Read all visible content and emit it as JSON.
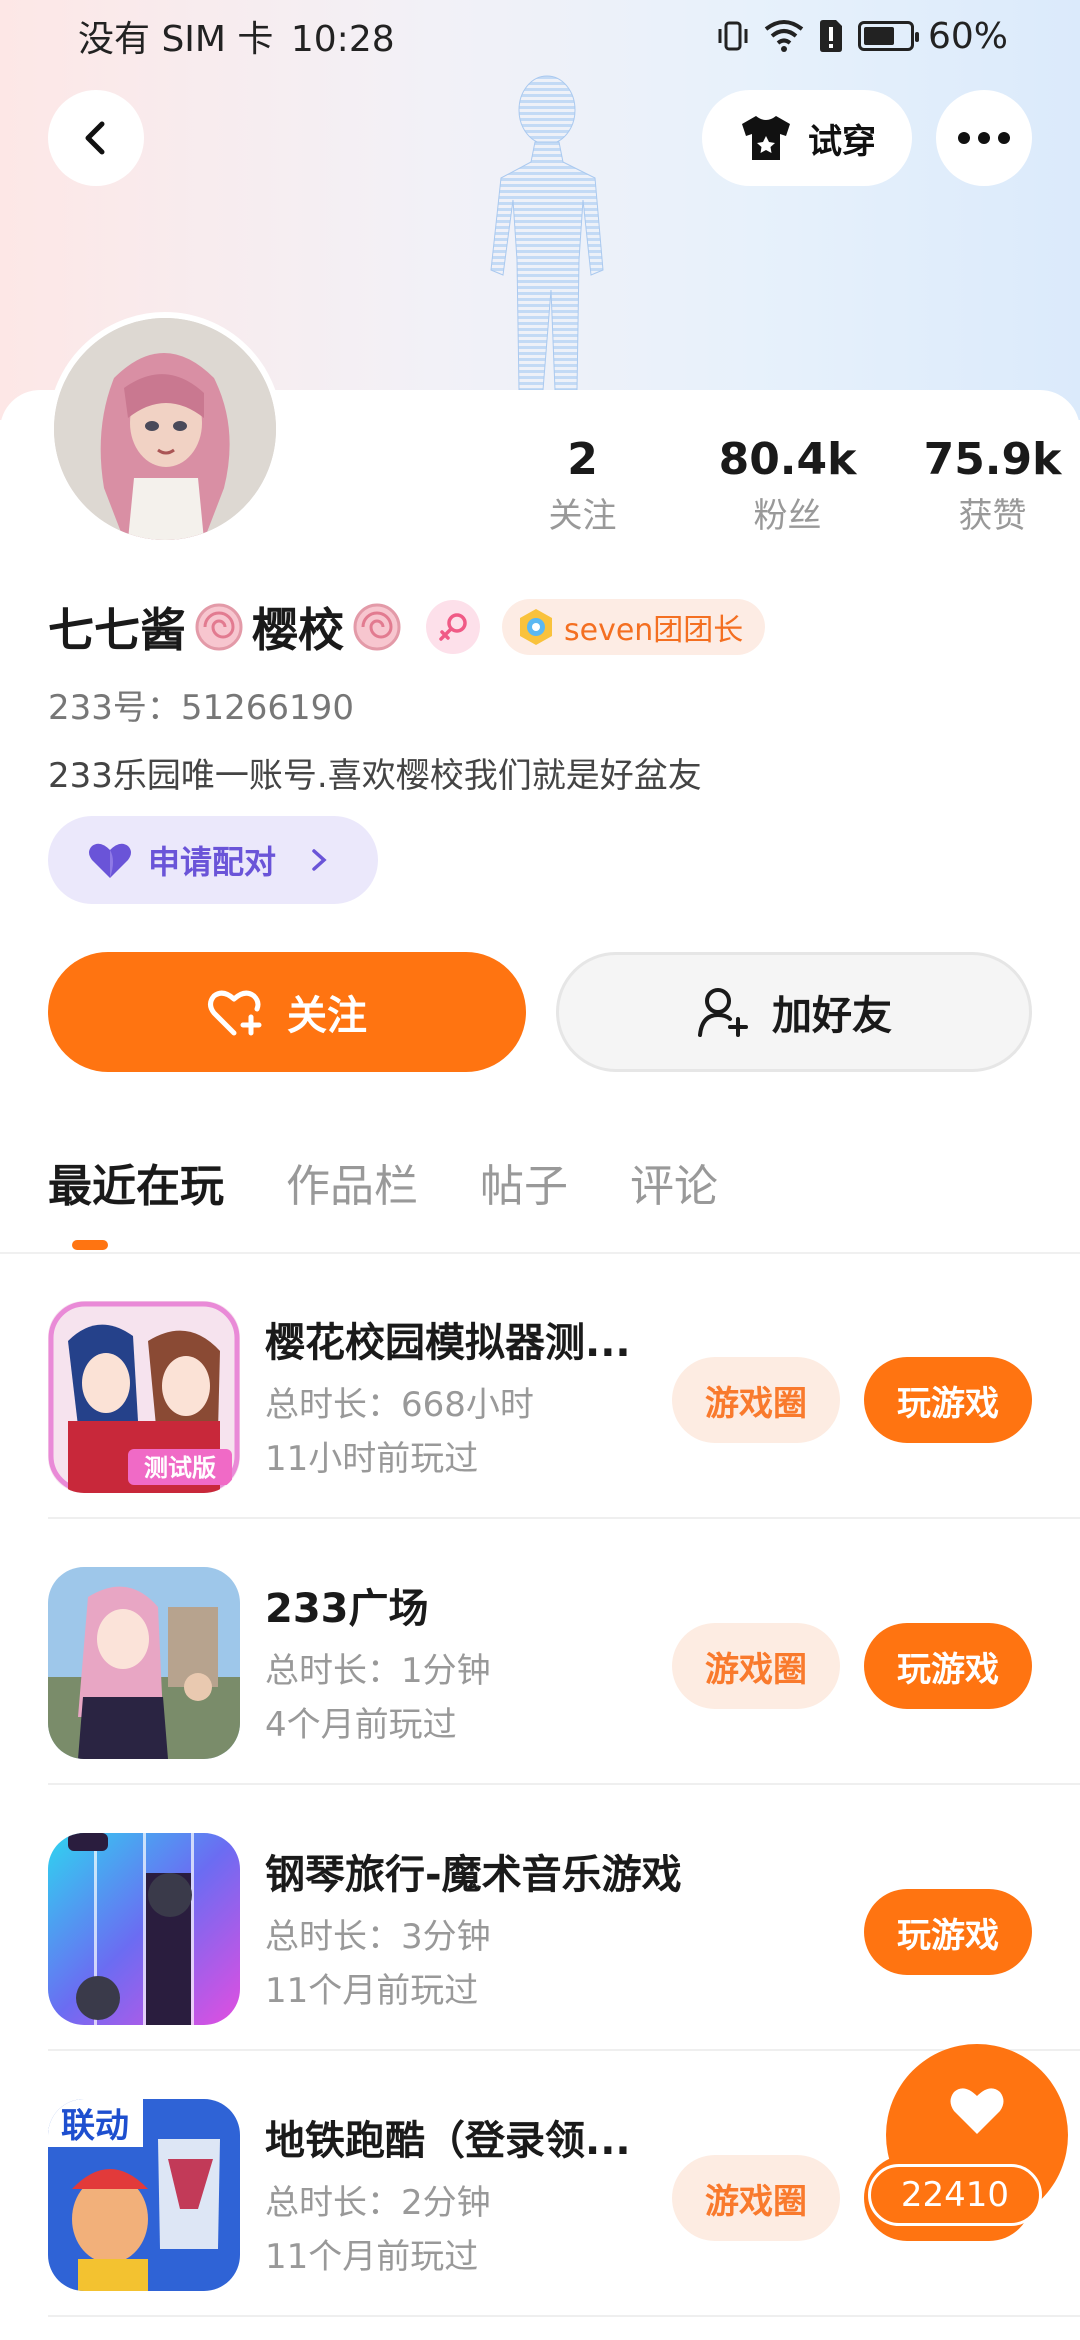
{
  "status_bar": {
    "carrier": "没有 SIM 卡",
    "time": "10:28",
    "battery": "60%"
  },
  "header": {
    "tryon_label": "试穿"
  },
  "profile": {
    "stats": [
      {
        "value": "2",
        "label": "关注"
      },
      {
        "value": "80.4k",
        "label": "粉丝"
      },
      {
        "value": "75.9k",
        "label": "获赞"
      }
    ],
    "name_part1": "七七酱",
    "name_part2": "樱校",
    "group_badge": "seven团团长",
    "uid": "233号：51266190",
    "bio": "233乐园唯一账号.喜欢樱校我们就是好盆友",
    "pair_label": "申请配对"
  },
  "actions": {
    "follow_label": "关注",
    "add_friend_label": "加好友"
  },
  "tabs": [
    "最近在玩",
    "作品栏",
    "帖子",
    "评论"
  ],
  "buttons": {
    "circle": "游戏圈",
    "play": "玩游戏"
  },
  "games": [
    {
      "title": "樱花校园模拟器测...",
      "duration": "总时长：668小时",
      "last_played": "11小时前玩过",
      "has_circle": true
    },
    {
      "title": "233广场",
      "duration": "总时长：1分钟",
      "last_played": "4个月前玩过",
      "has_circle": true
    },
    {
      "title": "钢琴旅行-魔术音乐游戏",
      "duration": "总时长：3分钟",
      "last_played": "11个月前玩过",
      "has_circle": false
    },
    {
      "title": "地铁跑酷（登录领...",
      "duration": "总时长：2分钟",
      "last_played": "11个月前玩过",
      "has_circle": true
    }
  ],
  "game_icon_text": {
    "g1": "测试版",
    "g4": "联动"
  },
  "float_like": {
    "count": "22410"
  },
  "colors": {
    "accent": "#ff7411",
    "pair": "#6a54d8"
  }
}
